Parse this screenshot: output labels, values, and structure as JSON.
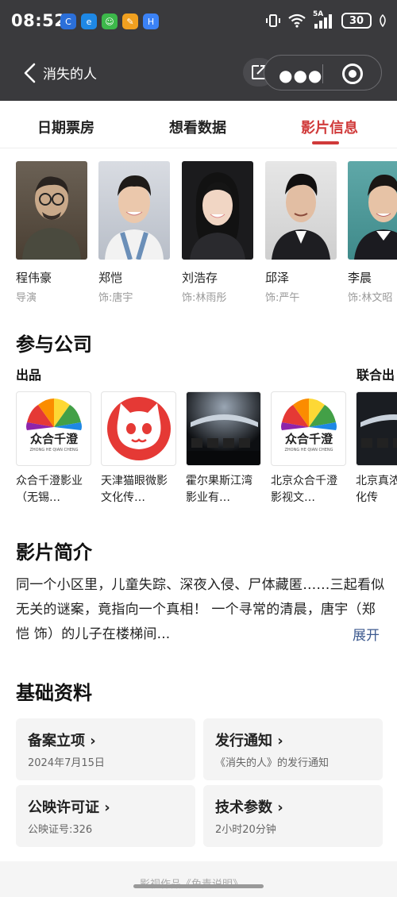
{
  "status": {
    "time": "08:52",
    "battery": "30",
    "network": "5A"
  },
  "header": {
    "title": "消失的人"
  },
  "tabs": [
    {
      "label": "日期票房"
    },
    {
      "label": "想看数据"
    },
    {
      "label": "影片信息"
    }
  ],
  "active_tab": "影片信息",
  "cast": [
    {
      "name": "程伟豪",
      "role": "导演"
    },
    {
      "name": "郑恺",
      "role": "饰:唐宇"
    },
    {
      "name": "刘浩存",
      "role": "饰:林雨彤"
    },
    {
      "name": "邱泽",
      "role": "饰:严午"
    },
    {
      "name": "李晨",
      "role": "饰:林文昭"
    }
  ],
  "companies_section": {
    "title": "参与公司",
    "group1": "出品",
    "group2": "联合出",
    "items": [
      {
        "name": "众合千澄影业（无锡…",
        "logo": "zhonghe-logo"
      },
      {
        "name": "天津猫眼微影文化传…",
        "logo": "maoyan-logo"
      },
      {
        "name": "霍尔果斯江湾影业有…",
        "logo": "cinema-seats-logo"
      },
      {
        "name": "北京众合千澄影视文…",
        "logo": "zhonghe-logo"
      },
      {
        "name": "北京真浓视文化传",
        "logo": "cinema-seats-logo"
      }
    ],
    "logo_text": "众合千澄",
    "logo_subtext": "ZHONG HE QIAN CHENG"
  },
  "synopsis": {
    "title": "影片简介",
    "text": "同一个小区里，儿童失踪、深夜入侵、尸体藏匿……三起看似无关的谜案，竟指向一个真相！ 一个寻常的清晨，唐宇（郑恺 饰）的儿子在楼梯间...",
    "expand_label": "展开"
  },
  "basic_info": {
    "title": "基础资料",
    "cards": [
      {
        "title": "备案立项",
        "sub": "2024年7月15日"
      },
      {
        "title": "发行通知",
        "sub": "《消失的人》的发行通知"
      },
      {
        "title": "公映许可证",
        "sub": "公映证号:326"
      },
      {
        "title": "技术参数",
        "sub": "2小时20分钟"
      }
    ]
  },
  "footer": {
    "text": "影视作品《免责说明》"
  },
  "colors": {
    "accent": "#d03a3a",
    "link": "#3d5a8f",
    "topbar": "#3a3a3d"
  }
}
